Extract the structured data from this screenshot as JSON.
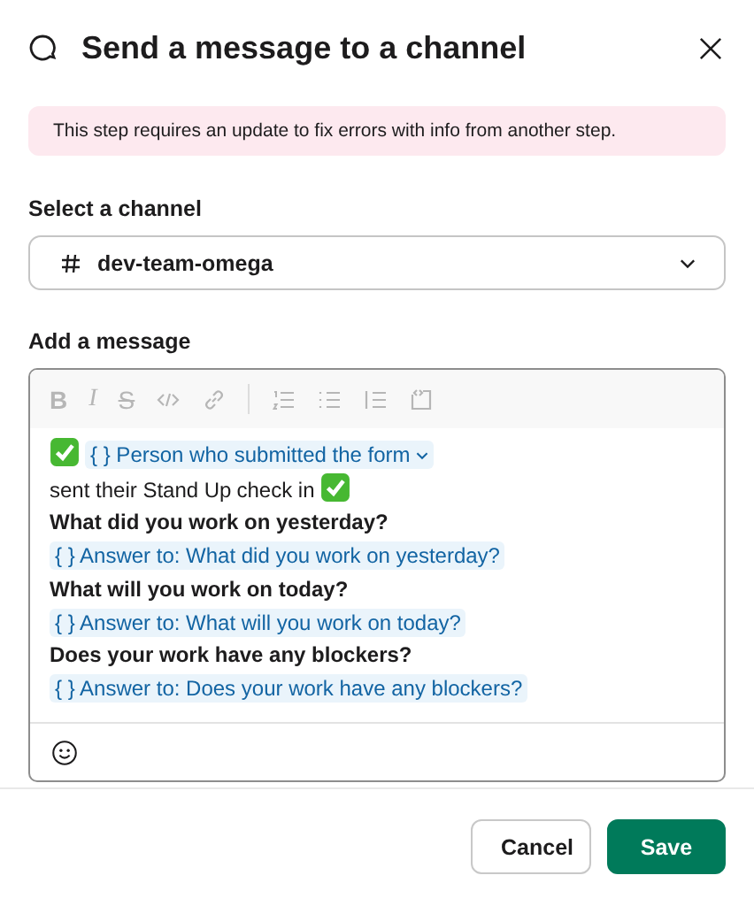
{
  "dialog": {
    "title": "Send a message to a channel"
  },
  "alert": {
    "text": "This step requires an update to fix errors with info from another step."
  },
  "channel": {
    "label": "Select a channel",
    "value": "dev-team-omega"
  },
  "message": {
    "label": "Add a message",
    "toolbar": [
      {
        "kind": "bold",
        "label": "B"
      },
      {
        "kind": "italic",
        "label": "I"
      },
      {
        "kind": "strike",
        "label": "S"
      },
      {
        "kind": "code"
      },
      {
        "kind": "link"
      },
      {
        "kind": "separator"
      },
      {
        "kind": "numbered"
      },
      {
        "kind": "bulleted"
      },
      {
        "kind": "quote"
      },
      {
        "kind": "codeblock"
      }
    ],
    "lines": [
      {
        "segments": [
          {
            "kind": "emoji"
          },
          {
            "kind": "token",
            "text": "{ } Person who submitted the form",
            "dropdown": true
          },
          {
            "kind": "text",
            "text": "sent their Stand Up"
          },
          {
            "kind": "text",
            "text": "check in"
          },
          {
            "kind": "emoji"
          }
        ]
      },
      {
        "segments": [
          {
            "kind": "bold",
            "text": "What did you work on yesterday?"
          }
        ]
      },
      {
        "segments": [
          {
            "kind": "token",
            "text": "{ } Answer to: What did you work on yesterday?",
            "dropdown": false
          }
        ]
      },
      {
        "segments": [
          {
            "kind": "bold",
            "text": "What will you work on today?"
          }
        ]
      },
      {
        "segments": [
          {
            "kind": "token",
            "text": "{ } Answer to: What will you work on today?",
            "dropdown": false
          }
        ]
      },
      {
        "segments": [
          {
            "kind": "bold",
            "text": "Does your work have any blockers?"
          }
        ]
      },
      {
        "segments": [
          {
            "kind": "token",
            "text": "{ } Answer to: Does your work have any blockers?",
            "dropdown": false
          }
        ]
      }
    ]
  },
  "buttons": [
    {
      "kind": "secondary",
      "label": "Cancel"
    },
    {
      "kind": "primary",
      "label": "Save"
    }
  ]
}
